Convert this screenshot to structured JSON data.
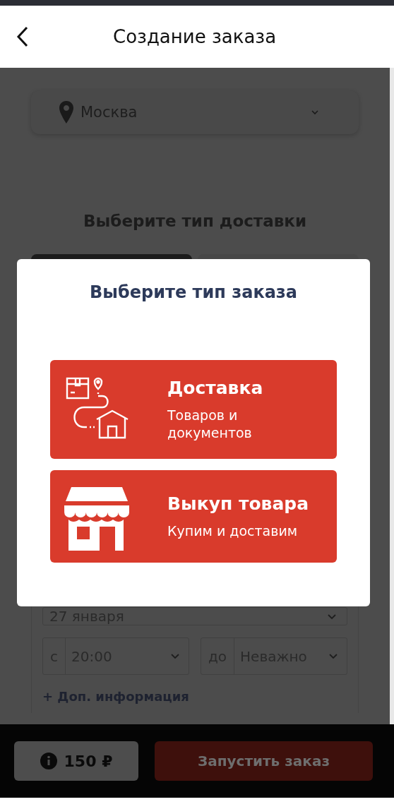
{
  "header": {
    "title": "Создание заказа"
  },
  "city_select": {
    "value": "Москва"
  },
  "delivery_section": {
    "heading": "Выберите тип доставки",
    "tabs": [
      {
        "selected": true
      },
      {
        "selected": false
      }
    ]
  },
  "date_select": {
    "value": "27 января"
  },
  "time_from": {
    "label": "с",
    "value": "20:00"
  },
  "time_to": {
    "label": "до",
    "value": "Неважно"
  },
  "more_info_link": "+ Доп. информация",
  "footer": {
    "price": "150 ₽",
    "submit": "Запустить заказ"
  },
  "modal": {
    "title": "Выберите тип заказа",
    "options": [
      {
        "kind": "delivery",
        "title": "Доставка",
        "subtitle": "Товаров и документов"
      },
      {
        "kind": "purchase",
        "title": "Выкуп товара",
        "subtitle": "Купим и доставим"
      }
    ]
  }
}
